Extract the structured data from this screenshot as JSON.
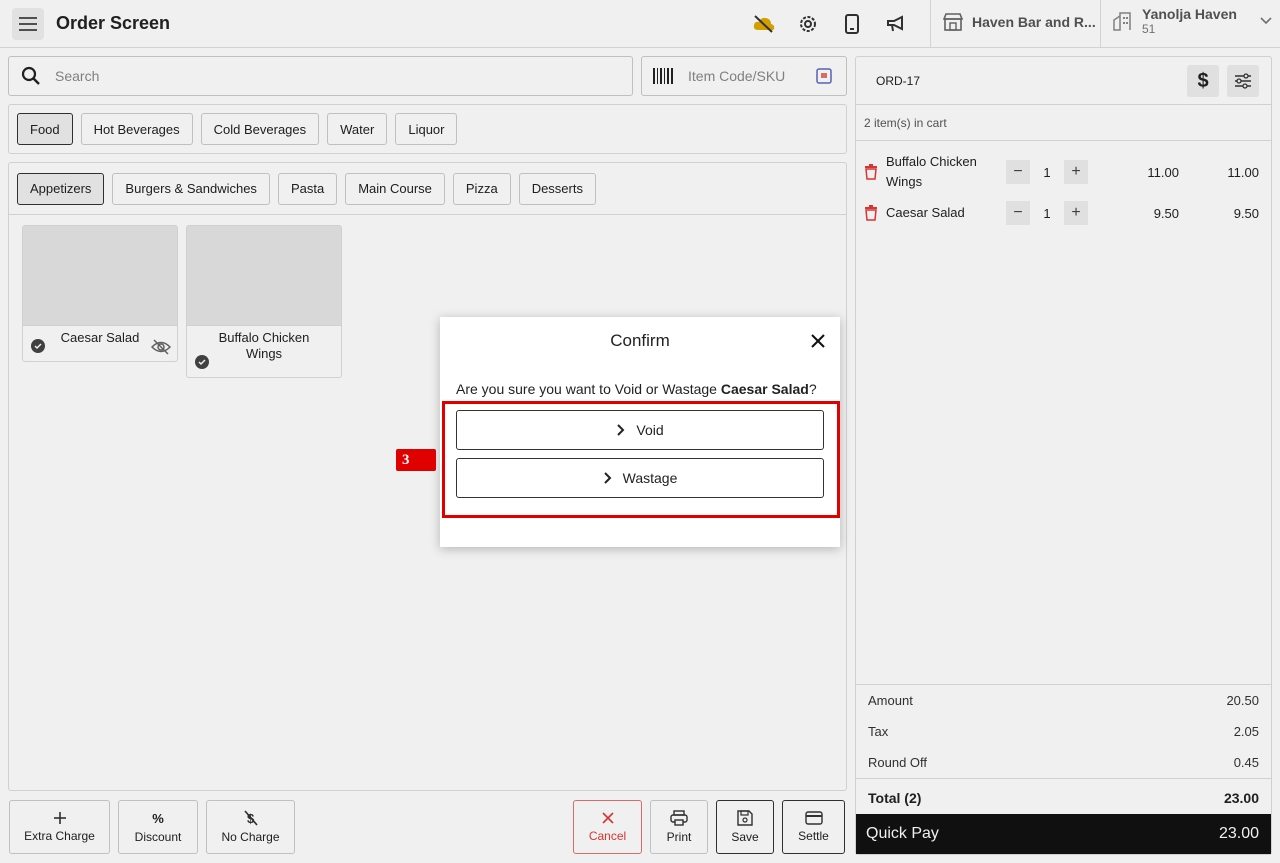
{
  "header": {
    "title": "Order Screen",
    "location": "Haven Bar and R...",
    "org_name": "Yanolja Haven",
    "org_sub": "51"
  },
  "search": {
    "placeholder": "Search"
  },
  "sku": {
    "placeholder": "Item Code/SKU"
  },
  "categories": [
    "Food",
    "Hot Beverages",
    "Cold Beverages",
    "Water",
    "Liquor"
  ],
  "subcategories": [
    "Appetizers",
    "Burgers & Sandwiches",
    "Pasta",
    "Main Course",
    "Pizza",
    "Desserts"
  ],
  "products": [
    {
      "name": "Caesar Salad"
    },
    {
      "name": "Buffalo Chicken Wings"
    }
  ],
  "bottom_actions": {
    "extra_charge": "Extra Charge",
    "discount": "Discount",
    "no_charge": "No Charge",
    "cancel": "Cancel",
    "print": "Print",
    "save": "Save",
    "settle": "Settle"
  },
  "cart": {
    "order_id": "ORD-17",
    "count_text": "2 item(s) in cart",
    "items": [
      {
        "name": "Buffalo Chicken Wings",
        "qty": "1",
        "price": "11.00",
        "total": "11.00"
      },
      {
        "name": "Caesar Salad",
        "qty": "1",
        "price": "9.50",
        "total": "9.50"
      }
    ],
    "summary": {
      "amount_label": "Amount",
      "amount": "20.50",
      "tax_label": "Tax",
      "tax": "2.05",
      "roundoff_label": "Round Off",
      "roundoff": "0.45",
      "total_label": "Total (2)",
      "total": "23.00"
    },
    "quick_pay_label": "Quick Pay",
    "quick_pay_amount": "23.00"
  },
  "dialog": {
    "title": "Confirm",
    "message_prefix": "Are you sure you want to Void or Wastage ",
    "message_item": "Caesar Salad",
    "message_suffix": "?",
    "void_label": "Void",
    "wastage_label": "Wastage"
  },
  "annotation": {
    "step": "3",
    "color": "#e00000"
  }
}
